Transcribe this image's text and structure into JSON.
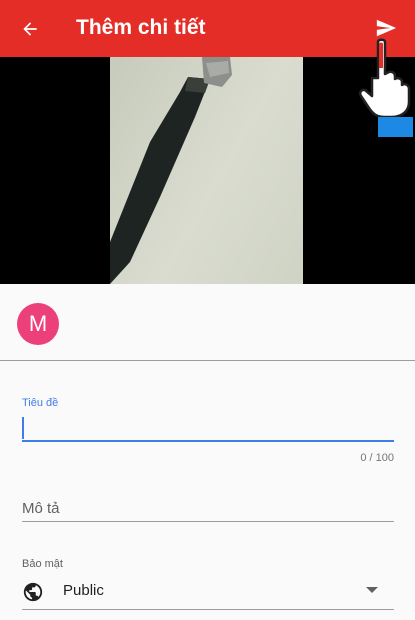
{
  "colors": {
    "app_bar": "#e52d27",
    "accent": "#3f7de8",
    "avatar": "#ec407a",
    "hint": "#1e88e5"
  },
  "header": {
    "title": "Thêm chi tiết",
    "back_icon": "arrow-back-icon",
    "send_icon": "send-icon"
  },
  "channel": {
    "avatar_letter": "M"
  },
  "form": {
    "title_label": "Tiêu đề",
    "title_value": "",
    "char_counter": "0 / 100",
    "description_placeholder": "Mô tả",
    "privacy_label": "Bảo mật",
    "privacy_value": "Public",
    "privacy_icon": "globe-icon"
  }
}
